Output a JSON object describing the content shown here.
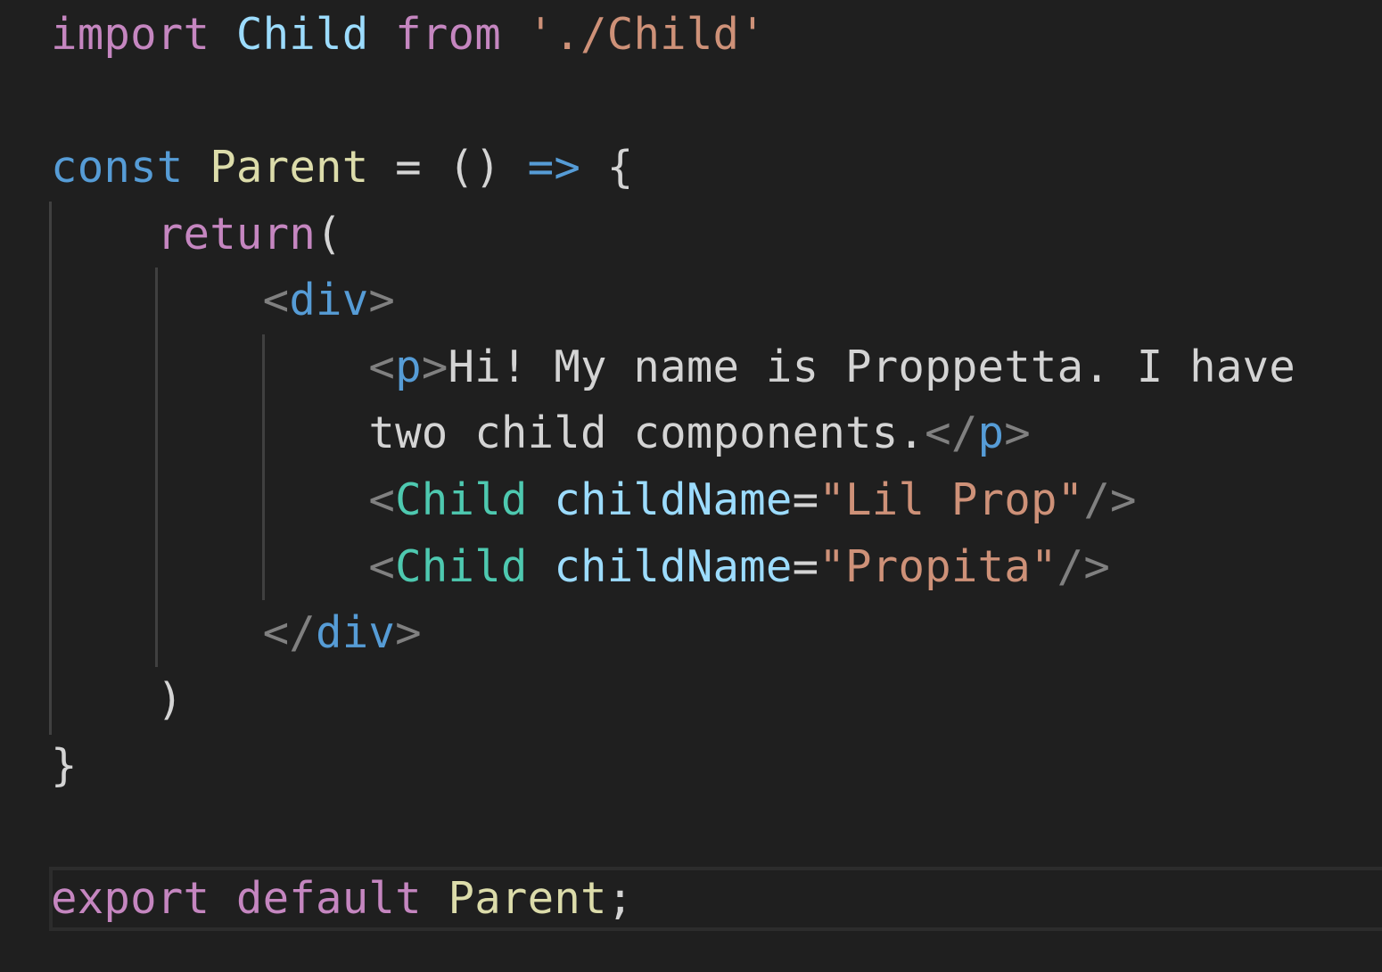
{
  "editor": {
    "language": "jsx",
    "colors": {
      "background": "#1f1f1f",
      "keyword_control": "#c586c0",
      "keyword_declaration": "#569cd6",
      "variable": "#9cdcfe",
      "function_name": "#dcdcaa",
      "string": "#ce9178",
      "component": "#4ec9b0",
      "tag_bracket": "#808080"
    },
    "lines": [
      {
        "tokens": [
          "import",
          " ",
          "Child",
          " ",
          "from",
          " ",
          "'./Child'"
        ]
      },
      {
        "tokens": []
      },
      {
        "tokens": [
          "const",
          " ",
          "Parent",
          " ",
          "=",
          " ",
          "()",
          " ",
          "=>",
          " ",
          "{"
        ]
      },
      {
        "tokens": [
          "    ",
          "return",
          "("
        ]
      },
      {
        "tokens": [
          "        ",
          "<",
          "div",
          ">"
        ]
      },
      {
        "tokens": [
          "            ",
          "<",
          "p",
          ">",
          "Hi! My name is Proppetta. I have"
        ]
      },
      {
        "tokens": [
          "            ",
          "two child components.",
          "</",
          "p",
          ">"
        ]
      },
      {
        "tokens": [
          "            ",
          "<",
          "Child",
          " ",
          "childName",
          "=",
          "\"Lil Prop\"",
          "/>"
        ]
      },
      {
        "tokens": [
          "            ",
          "<",
          "Child",
          " ",
          "childName",
          "=",
          "\"Propita\"",
          "/>"
        ]
      },
      {
        "tokens": [
          "        ",
          "</",
          "div",
          ">"
        ]
      },
      {
        "tokens": [
          "    ",
          ")"
        ]
      },
      {
        "tokens": [
          "}"
        ]
      },
      {
        "tokens": []
      },
      {
        "tokens": [
          "export",
          " ",
          "default",
          " ",
          "Parent",
          ";"
        ]
      }
    ]
  }
}
